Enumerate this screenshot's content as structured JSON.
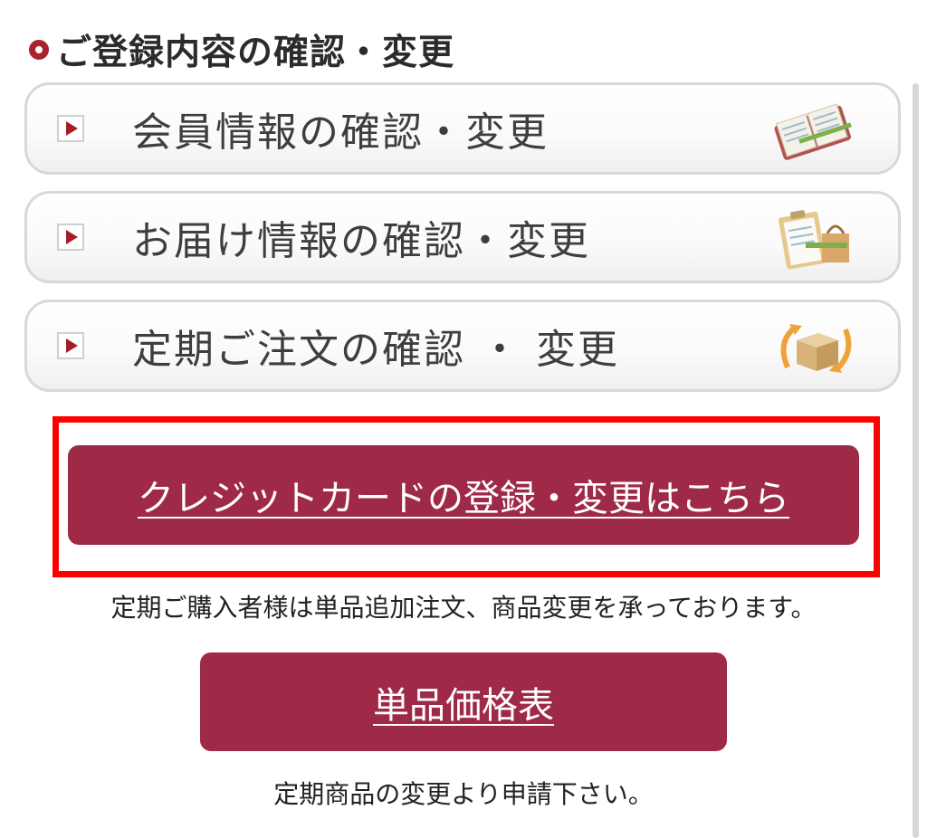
{
  "section": {
    "title": "ご登録内容の確認・変更"
  },
  "menu": [
    {
      "label": "会員情報の確認・変更",
      "icon": "notebook-icon"
    },
    {
      "label": "お届け情報の確認・変更",
      "icon": "clipboard-bag-icon"
    },
    {
      "label": "定期ご注文の確認 ・ 変更",
      "icon": "box-refresh-icon"
    }
  ],
  "credit_card": {
    "label": "クレジットカードの登録・変更はこちら"
  },
  "notes": {
    "subscriber": "定期ご購入者様は単品追加注文、商品変更を承っております。",
    "apply": "定期商品の変更より申請下さい。"
  },
  "price_table": {
    "label": "単品価格表"
  },
  "colors": {
    "accent": "#9e2a47",
    "highlight_frame": "#ff0000",
    "arrow": "#a51d2a"
  }
}
